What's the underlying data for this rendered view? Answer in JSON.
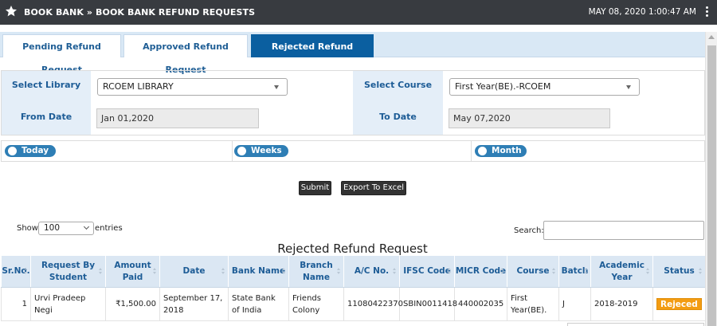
{
  "header": {
    "title": "BOOK BANK » BOOK BANK REFUND REQUESTS",
    "date": "MAY 08, 2020",
    "time": "1:00:47 AM",
    "icons": [
      "star-icon",
      "kebab-menu-icon"
    ]
  },
  "tabs": [
    {
      "label": "Pending Refund Request",
      "active": false
    },
    {
      "label": "Approved Refund Request",
      "active": false
    },
    {
      "label": "Rejected Refund Request",
      "active": true
    }
  ],
  "filters": {
    "library_label": "Select Library",
    "library_value": "RCOEM LIBRARY",
    "course_label": "Select Course",
    "course_value": "First Year(BE).-RCOEM",
    "from_label": "From Date",
    "from_value": "Jan 01,2020",
    "to_label": "To Date",
    "to_value": "May 07,2020"
  },
  "periods": [
    "Today",
    "Weeks",
    "Month"
  ],
  "buttons": {
    "submit": "Submit",
    "export": "Export To Excel"
  },
  "listing": {
    "show_label": "Show",
    "entries_value": "100",
    "entries_label": "entries",
    "search_label": "Search:",
    "title": "Rejected Refund Request"
  },
  "table": {
    "columns": [
      "Sr.No.",
      "Request By Student",
      "Amount Paid",
      "Date",
      "Bank Name",
      "Branch Name",
      "A/C No.",
      "IFSC Code",
      "MICR Code",
      "Course",
      "Batch",
      "Academic Year",
      "Status"
    ],
    "rows": [
      [
        "1",
        "Urvi Pradeep Negi",
        "₹1,500.00",
        "September 17, 2018",
        "State Bank of India",
        "Friends Colony",
        "11080422370",
        "SBIN0011418",
        "440002035",
        "First Year(BE).",
        "J",
        "2018-2019",
        "Rejeced"
      ]
    ]
  },
  "colors": {
    "topbar": "#383b40",
    "tab_active": "#0b5fa0",
    "label_bg": "#e4eef8",
    "pill": "#2e7eb5",
    "status_badge": "#f39c12"
  }
}
